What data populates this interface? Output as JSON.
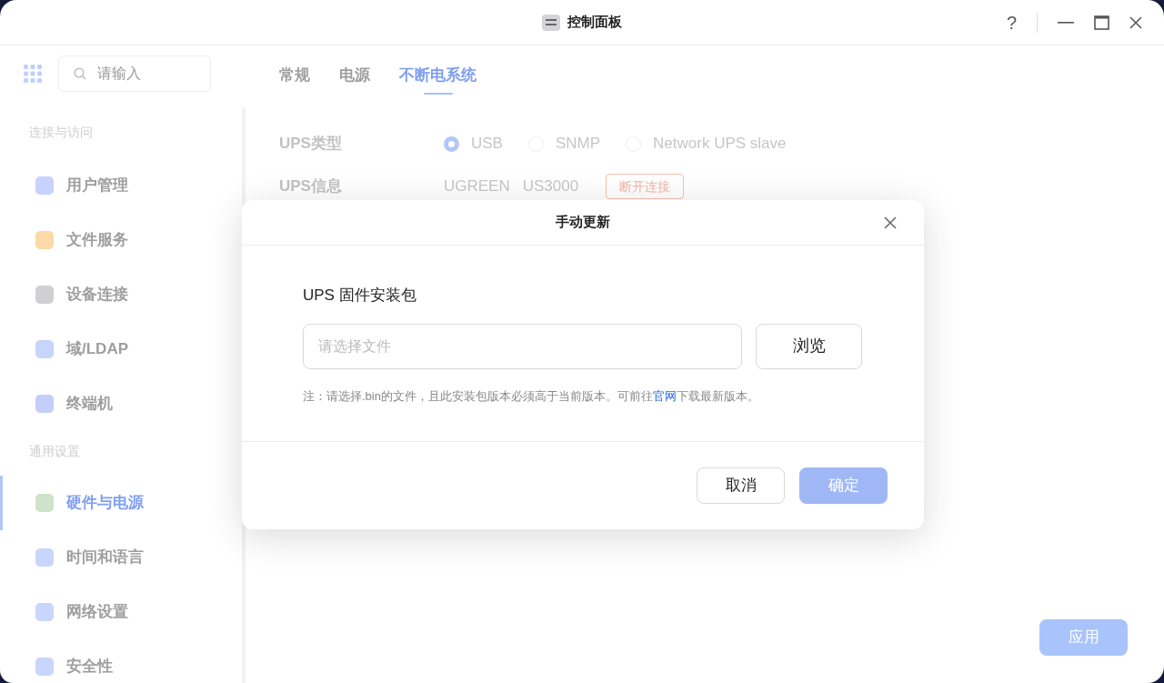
{
  "window": {
    "title": "控制面板",
    "help": "?"
  },
  "search": {
    "placeholder": "请输入"
  },
  "sidebar": {
    "sections": [
      {
        "title": "连接与访问",
        "items": [
          {
            "label": "用户管理",
            "selected": false
          },
          {
            "label": "文件服务",
            "selected": false
          },
          {
            "label": "设备连接",
            "selected": false
          },
          {
            "label": "域/LDAP",
            "selected": false
          },
          {
            "label": "终端机",
            "selected": false
          }
        ]
      },
      {
        "title": "通用设置",
        "items": [
          {
            "label": "硬件与电源",
            "selected": true
          },
          {
            "label": "时间和语言",
            "selected": false
          },
          {
            "label": "网络设置",
            "selected": false
          },
          {
            "label": "安全性",
            "selected": false
          }
        ]
      }
    ]
  },
  "tabs": [
    {
      "label": "常规",
      "selected": false
    },
    {
      "label": "电源",
      "selected": false
    },
    {
      "label": "不断电系统",
      "selected": true
    }
  ],
  "ups_type": {
    "label": "UPS类型",
    "options": [
      {
        "label": "USB",
        "selected": true
      },
      {
        "label": "SNMP",
        "selected": false
      },
      {
        "label": "Network UPS slave",
        "selected": false
      }
    ]
  },
  "ups_info": {
    "label": "UPS信息",
    "brand": "UGREEN",
    "model": "US3000",
    "disconnect_button": "断开连接"
  },
  "apply_button": "应用",
  "dialog": {
    "title": "手动更新",
    "field_label": "UPS 固件安装包",
    "file_field": {
      "placeholder": "请选择文件"
    },
    "browse_button": "浏览",
    "note_before": "注：请选择.bin的文件，且此安装包版本必须高于当前版本。可前往",
    "note_link": "官网",
    "note_after": "下载最新版本。",
    "cancel_button": "取消",
    "confirm_button": {
      "label": "确定",
      "disabled": true
    }
  }
}
